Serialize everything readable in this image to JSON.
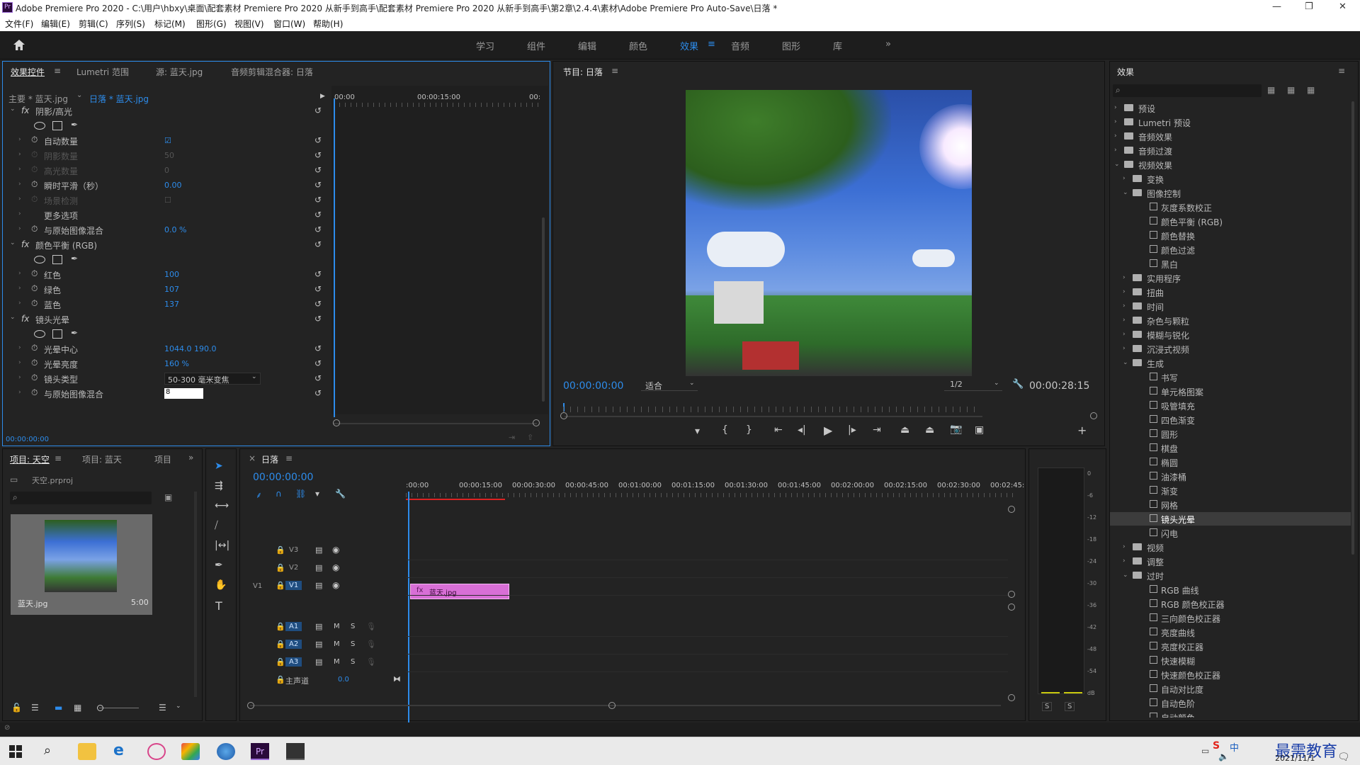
{
  "titlebar": {
    "app_icon": "Pr",
    "title": "Adobe Premiere Pro 2020 - C:\\用户\\hbxy\\桌面\\配套素材 Premiere Pro 2020 从新手到高手\\配套素材 Premiere Pro 2020 从新手到高手\\第2章\\2.4.4\\素材\\Adobe Premiere Pro Auto-Save\\日落 *",
    "minimize": "—",
    "maximize": "❐",
    "close": "✕"
  },
  "menu": [
    "文件(F)",
    "编辑(E)",
    "剪辑(C)",
    "序列(S)",
    "标记(M)",
    "图形(G)",
    "视图(V)",
    "窗口(W)",
    "帮助(H)"
  ],
  "workspaces": [
    "学习",
    "组件",
    "编辑",
    "颜色",
    "效果",
    "音频",
    "图形",
    "库"
  ],
  "workspace_active": "效果",
  "effect_controls": {
    "tabs": [
      "效果控件",
      "Lumetri 范围",
      "源: 蓝天.jpg",
      "音频剪辑混合器: 日落"
    ],
    "master": "主要 * 蓝天.jpg",
    "seq": "日落 * 蓝天.jpg",
    "ruler": [
      "00:00",
      "00:00:15:00",
      "00:"
    ],
    "rows": [
      {
        "label": "阴影/高光",
        "kind": "fx",
        "value": ""
      },
      {
        "label": "自动数量",
        "kind": "prop",
        "value": "☑"
      },
      {
        "label": "阴影数量",
        "kind": "disabled",
        "value": "50"
      },
      {
        "label": "高光数量",
        "kind": "disabled",
        "value": "0"
      },
      {
        "label": "瞬时平滑（秒）",
        "kind": "prop",
        "value": "0.00"
      },
      {
        "label": "场景检测",
        "kind": "disabled",
        "value": "☐"
      },
      {
        "label": "更多选项",
        "kind": "group",
        "value": ""
      },
      {
        "label": "与原始图像混合",
        "kind": "prop",
        "value": "0.0 %"
      },
      {
        "label": "颜色平衡 (RGB)",
        "kind": "fx",
        "value": ""
      },
      {
        "label": "红色",
        "kind": "prop",
        "value": "100"
      },
      {
        "label": "绿色",
        "kind": "prop",
        "value": "107"
      },
      {
        "label": "蓝色",
        "kind": "prop",
        "value": "137"
      },
      {
        "label": "镜头光晕",
        "kind": "fx",
        "value": ""
      },
      {
        "label": "光晕中心",
        "kind": "prop",
        "value": "1044.0    190.0"
      },
      {
        "label": "光晕亮度",
        "kind": "prop",
        "value": "160 %"
      },
      {
        "label": "镜头类型",
        "kind": "select",
        "value": "50-300 毫米变焦"
      },
      {
        "label": "与原始图像混合",
        "kind": "input",
        "value": "8"
      }
    ],
    "timecode": "00:00:00:00"
  },
  "program": {
    "title": "节目: 日落",
    "timecode": "00:00:00:00",
    "fit": "适合",
    "res": "1/2",
    "duration": "00:00:28:15"
  },
  "effects": {
    "title": "效果",
    "tree": [
      {
        "d": 0,
        "t": "folder",
        "o": false,
        "l": "预设"
      },
      {
        "d": 0,
        "t": "folder",
        "o": false,
        "l": "Lumetri 预设"
      },
      {
        "d": 0,
        "t": "folder",
        "o": false,
        "l": "音频效果"
      },
      {
        "d": 0,
        "t": "folder",
        "o": false,
        "l": "音频过渡"
      },
      {
        "d": 0,
        "t": "folder",
        "o": true,
        "l": "视频效果"
      },
      {
        "d": 1,
        "t": "folder",
        "o": false,
        "l": "变换"
      },
      {
        "d": 1,
        "t": "folder",
        "o": true,
        "l": "图像控制"
      },
      {
        "d": 2,
        "t": "fx",
        "l": "灰度系数校正"
      },
      {
        "d": 2,
        "t": "fx",
        "l": "颜色平衡 (RGB)"
      },
      {
        "d": 2,
        "t": "fx",
        "l": "颜色替换"
      },
      {
        "d": 2,
        "t": "fx",
        "l": "颜色过滤"
      },
      {
        "d": 2,
        "t": "fx",
        "l": "黑白"
      },
      {
        "d": 1,
        "t": "folder",
        "o": false,
        "l": "实用程序"
      },
      {
        "d": 1,
        "t": "folder",
        "o": false,
        "l": "扭曲"
      },
      {
        "d": 1,
        "t": "folder",
        "o": false,
        "l": "时间"
      },
      {
        "d": 1,
        "t": "folder",
        "o": false,
        "l": "杂色与颗粒"
      },
      {
        "d": 1,
        "t": "folder",
        "o": false,
        "l": "模糊与锐化"
      },
      {
        "d": 1,
        "t": "folder",
        "o": false,
        "l": "沉浸式视频"
      },
      {
        "d": 1,
        "t": "folder",
        "o": true,
        "l": "生成"
      },
      {
        "d": 2,
        "t": "fx",
        "l": "书写"
      },
      {
        "d": 2,
        "t": "fx",
        "l": "单元格图案"
      },
      {
        "d": 2,
        "t": "fx",
        "l": "吸管填充"
      },
      {
        "d": 2,
        "t": "fx",
        "l": "四色渐变"
      },
      {
        "d": 2,
        "t": "fx",
        "l": "圆形"
      },
      {
        "d": 2,
        "t": "fx",
        "l": "棋盘"
      },
      {
        "d": 2,
        "t": "fx",
        "l": "椭圆"
      },
      {
        "d": 2,
        "t": "fx",
        "l": "油漆桶"
      },
      {
        "d": 2,
        "t": "fx",
        "l": "渐变"
      },
      {
        "d": 2,
        "t": "fx",
        "l": "网格"
      },
      {
        "d": 2,
        "t": "fx",
        "l": "镜头光晕",
        "sel": true
      },
      {
        "d": 2,
        "t": "fx",
        "l": "闪电"
      },
      {
        "d": 1,
        "t": "folder",
        "o": false,
        "l": "视频"
      },
      {
        "d": 1,
        "t": "folder",
        "o": false,
        "l": "调整"
      },
      {
        "d": 1,
        "t": "folder",
        "o": true,
        "l": "过时"
      },
      {
        "d": 2,
        "t": "fx",
        "l": "RGB 曲线"
      },
      {
        "d": 2,
        "t": "fx",
        "l": "RGB 颜色校正器"
      },
      {
        "d": 2,
        "t": "fx",
        "l": "三向颜色校正器"
      },
      {
        "d": 2,
        "t": "fx",
        "l": "亮度曲线"
      },
      {
        "d": 2,
        "t": "fx",
        "l": "亮度校正器"
      },
      {
        "d": 2,
        "t": "fx",
        "l": "快速模糊"
      },
      {
        "d": 2,
        "t": "fx",
        "l": "快速颜色校正器"
      },
      {
        "d": 2,
        "t": "fx",
        "l": "自动对比度"
      },
      {
        "d": 2,
        "t": "fx",
        "l": "自动色阶"
      },
      {
        "d": 2,
        "t": "fx",
        "l": "自动颜色"
      }
    ]
  },
  "project": {
    "tabs": [
      "项目: 天空",
      "项目: 蓝天",
      "项目"
    ],
    "file": "天空.prproj",
    "clip_name": "蓝天.jpg",
    "clip_dur": "5:00"
  },
  "timeline": {
    "title": "日落",
    "timecode": "00:00:00:00",
    "ruler": [
      ":00:00",
      "00:00:15:00",
      "00:00:30:00",
      "00:00:45:00",
      "00:01:00:00",
      "00:01:15:00",
      "00:01:30:00",
      "00:01:45:00",
      "00:02:00:00",
      "00:02:15:00",
      "00:02:30:00",
      "00:02:45:"
    ],
    "video_tracks": [
      "V3",
      "V2",
      "V1"
    ],
    "audio_tracks": [
      "A1",
      "A2",
      "A3"
    ],
    "src_v": "V1",
    "master": "主声道",
    "master_val": "0.0",
    "clip": "蓝天.jpg",
    "m": "M",
    "s": "S"
  },
  "meter": {
    "ticks": [
      "0",
      "-6",
      "-12",
      "-18",
      "-24",
      "-30",
      "-36",
      "-42",
      "-48",
      "-54",
      "dB"
    ],
    "s1": "S",
    "s2": "S"
  },
  "tray": {
    "ime": "中",
    "clock": "2021/11/1",
    "watermark": "最需教育"
  }
}
